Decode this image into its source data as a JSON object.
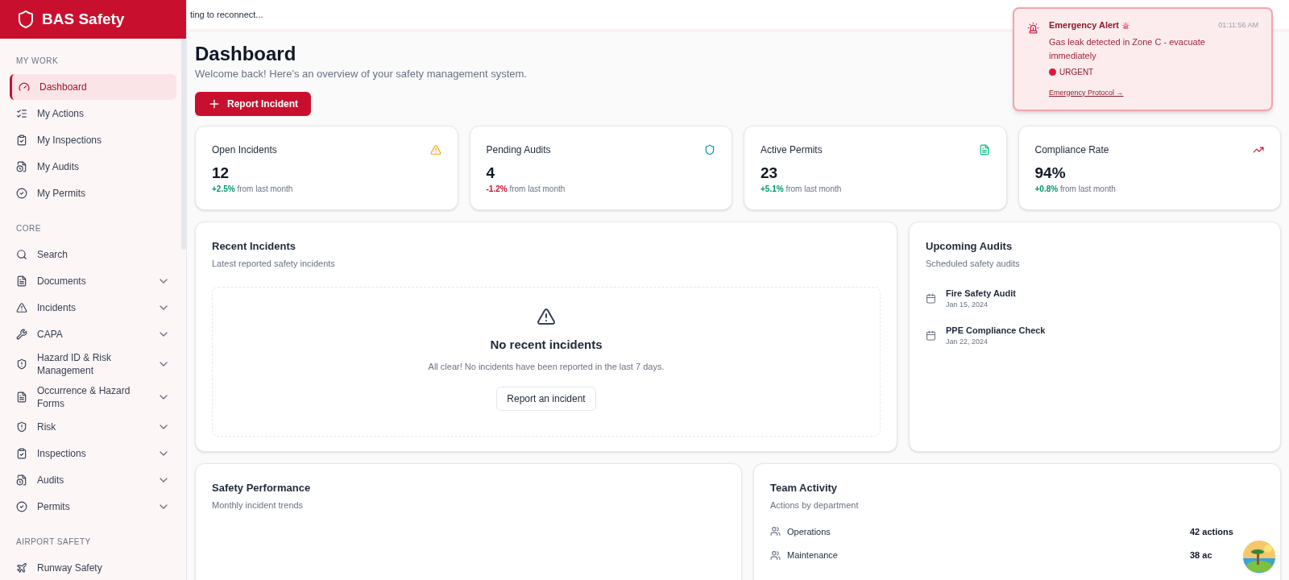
{
  "brand": "BAS Safety",
  "banner": "ting to reconnect...",
  "sidebar": {
    "sections": [
      {
        "title": "MY WORK",
        "items": [
          {
            "label": "Dashboard",
            "selected": true,
            "submenu": false
          },
          {
            "label": "My Actions",
            "selected": false,
            "submenu": false
          },
          {
            "label": "My Inspections",
            "selected": false,
            "submenu": false
          },
          {
            "label": "My Audits",
            "selected": false,
            "submenu": false
          },
          {
            "label": "My Permits",
            "selected": false,
            "submenu": false
          }
        ]
      },
      {
        "title": "CORE",
        "items": [
          {
            "label": "Search",
            "selected": false,
            "submenu": false
          },
          {
            "label": "Documents",
            "selected": false,
            "submenu": true
          },
          {
            "label": "Incidents",
            "selected": false,
            "submenu": true
          },
          {
            "label": "CAPA",
            "selected": false,
            "submenu": true
          },
          {
            "label": "Hazard ID & Risk Management",
            "selected": false,
            "submenu": true
          },
          {
            "label": "Occurrence & Hazard Forms",
            "selected": false,
            "submenu": true
          },
          {
            "label": "Risk",
            "selected": false,
            "submenu": true
          },
          {
            "label": "Inspections",
            "selected": false,
            "submenu": true
          },
          {
            "label": "Audits",
            "selected": false,
            "submenu": true
          },
          {
            "label": "Permits",
            "selected": false,
            "submenu": true
          }
        ]
      },
      {
        "title": "AIRPORT SAFETY",
        "items": [
          {
            "label": "Runway Safety",
            "selected": false,
            "submenu": false
          }
        ]
      }
    ]
  },
  "page": {
    "title": "Dashboard",
    "subtitle": "Welcome back! Here's an overview of your safety management system.",
    "primary_button": "Report Incident"
  },
  "stats": [
    {
      "title": "Open Incidents",
      "value": "12",
      "change": "+2.5%",
      "color": "#059669",
      "note": "from last month"
    },
    {
      "title": "Pending Audits",
      "value": "4",
      "change": "-1.2%",
      "color": "#c8102e",
      "note": "from last month"
    },
    {
      "title": "Active Permits",
      "value": "23",
      "change": "+5.1%",
      "color": "#059669",
      "note": "from last month"
    },
    {
      "title": "Compliance Rate",
      "value": "94%",
      "change": "+0.8%",
      "color": "#059669",
      "note": "from last month"
    }
  ],
  "recent_incidents": {
    "title": "Recent Incidents",
    "subtitle": "Latest reported safety incidents",
    "empty_title": "No recent incidents",
    "empty_text": "All clear! No incidents have been reported in the last 7 days.",
    "button": "Report an incident"
  },
  "upcoming_audits": {
    "title": "Upcoming Audits",
    "subtitle": "Scheduled safety audits",
    "items": [
      {
        "name": "Fire Safety Audit",
        "date": "Jan 15, 2024"
      },
      {
        "name": "PPE Compliance Check",
        "date": "Jan 22, 2024"
      }
    ]
  },
  "safety_performance": {
    "title": "Safety Performance",
    "subtitle": "Monthly incident trends"
  },
  "team_activity": {
    "title": "Team Activity",
    "subtitle": "Actions by department",
    "rows": [
      {
        "department": "Operations",
        "count": "42 actions"
      },
      {
        "department": "Maintenance",
        "count": "38 ac"
      }
    ]
  },
  "alert": {
    "title": "Emergency Alert",
    "time": "01:11:56 AM",
    "message": "Gas leak detected in Zone C - evacuate immediately",
    "priority": "URGENT",
    "link": "Emergency Protocol →"
  }
}
